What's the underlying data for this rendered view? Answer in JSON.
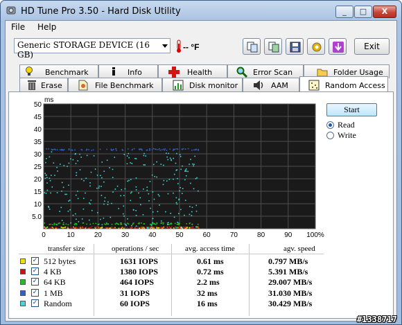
{
  "window": {
    "title": "HD Tune Pro 3.50 - Hard Disk Utility",
    "min_label": "_",
    "max_label": "□",
    "close_label": "X"
  },
  "menu": {
    "file": "File",
    "help": "Help"
  },
  "toolbar": {
    "device": "Generic STORAGE DEVICE (16 GB)",
    "temperature": "-- °F",
    "exit_label": "Exit",
    "icons": [
      "copy-info-icon",
      "copy-screen-icon",
      "save-icon",
      "options-icon",
      "minimize-to-tray-icon"
    ]
  },
  "tabs": {
    "row1": [
      "Benchmark",
      "Info",
      "Health",
      "Error Scan",
      "Folder Usage"
    ],
    "row2": [
      "Erase",
      "File Benchmark",
      "Disk monitor",
      "AAM",
      "Random Access"
    ],
    "active": "Random Access"
  },
  "controls": {
    "start_label": "Start",
    "read_label": "Read",
    "write_label": "Write",
    "mode": "Read"
  },
  "chart_data": {
    "type": "scatter",
    "ylabel": "ms",
    "y_ticks": [
      "50",
      "45",
      "40",
      "35",
      "30",
      "25",
      "20",
      "15",
      "10",
      "5.0"
    ],
    "x_ticks": [
      "0",
      "10",
      "20",
      "30",
      "40",
      "50",
      "60",
      "70",
      "80",
      "90",
      "100%"
    ],
    "xlim": [
      0,
      100
    ],
    "ylim": [
      0,
      50
    ],
    "grid": true,
    "background": "#1a1a1a",
    "series": [
      {
        "name": "512 bytes",
        "color": "#f0e000",
        "band": [
          0.3,
          0.9
        ],
        "x_max": 57
      },
      {
        "name": "4 KB",
        "color": "#d01010",
        "band": [
          0.4,
          1.0
        ],
        "x_max": 57
      },
      {
        "name": "64 KB",
        "color": "#20c020",
        "band": [
          1.8,
          2.6
        ],
        "x_max": 57
      },
      {
        "name": "1 MB",
        "color": "#3060c8",
        "band": [
          31.6,
          32.3
        ],
        "x_max": 57
      },
      {
        "name": "Random",
        "color": "#40d8d8",
        "band": [
          0.5,
          31
        ],
        "x_max": 57
      }
    ]
  },
  "results": {
    "headers": [
      "transfer size",
      "operations / sec",
      "avg. access time",
      "agv. speed"
    ],
    "rows": [
      {
        "size": "512 bytes",
        "color": "#f0e000",
        "checked": "✓",
        "iops": "1631 IOPS",
        "access": "0.61 ms",
        "speed": "0.797 MB/s"
      },
      {
        "size": "4 KB",
        "color": "#d01010",
        "checked": "✓",
        "iops": "1380 IOPS",
        "access": "0.72 ms",
        "speed": "5.391 MB/s"
      },
      {
        "size": "64 KB",
        "color": "#20c020",
        "checked": "✓",
        "iops": "464 IOPS",
        "access": "2.2 ms",
        "speed": "29.007 MB/s"
      },
      {
        "size": "1 MB",
        "color": "#3060c8",
        "checked": "✓",
        "iops": "31 IOPS",
        "access": "32 ms",
        "speed": "31.030 MB/s"
      },
      {
        "size": "Random",
        "color": "#40d8d8",
        "checked": "✓",
        "iops": "60 IOPS",
        "access": "16 ms",
        "speed": "30.429 MB/s"
      }
    ]
  },
  "watermark": "#1338717"
}
